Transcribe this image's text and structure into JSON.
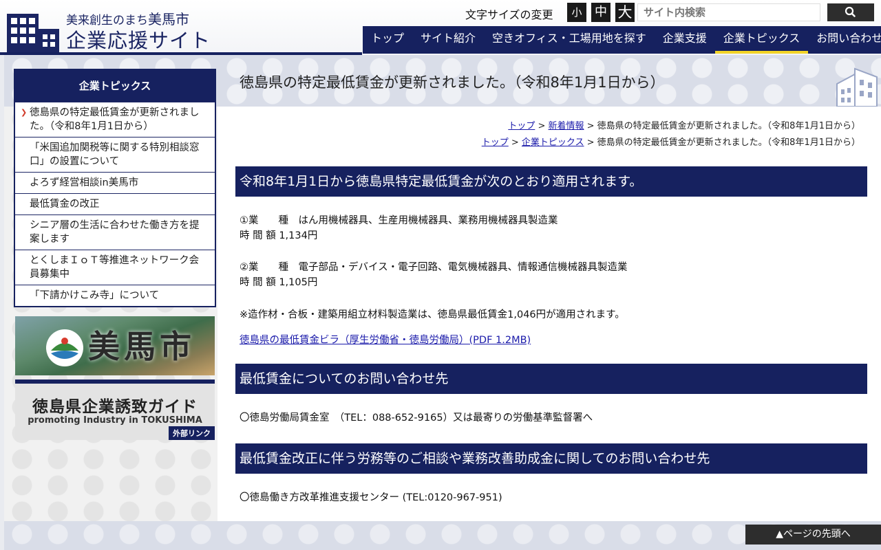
{
  "header": {
    "logo_sub": "美来創生のまち",
    "logo_city": "美馬市",
    "logo_main": "企業応援サイト",
    "fontsize_label": "文字サイズの変更",
    "fontsize_small": "小",
    "fontsize_mid": "中",
    "fontsize_large": "大",
    "search_placeholder": "サイト内検索"
  },
  "nav": [
    {
      "label": "トップ"
    },
    {
      "label": "サイト紹介"
    },
    {
      "label": "空きオフィス・工場用地を探す"
    },
    {
      "label": "企業支援"
    },
    {
      "label": "企業トピックス"
    },
    {
      "label": "お問い合わせ"
    }
  ],
  "sidebar": {
    "title": "企業トピックス",
    "items": [
      {
        "label": "徳島県の特定最低賃金が更新されました。（令和8年1月1日から）"
      },
      {
        "label": "「米国追加関税等に関する特別相談窓口」の設置について"
      },
      {
        "label": "よろず経営相談in美馬市"
      },
      {
        "label": "最低賃金の改正"
      },
      {
        "label": "シニア層の生活に合わせた働き方を提案します"
      },
      {
        "label": "とくしまＩｏＴ等推進ネットワーク会員募集中"
      },
      {
        "label": "「下請かけこみ寺」について"
      }
    ]
  },
  "banners": {
    "city_name": "美馬市",
    "guide_title": "徳島県企業誘致ガイド",
    "guide_sub": "promoting Industry in TOKUSHIMA",
    "guide_tag": "外部リンク"
  },
  "main": {
    "title": "徳島県の特定最低賃金が更新されました。（令和8年1月1日から）",
    "breadcrumb1": {
      "home": "トップ",
      "parent": "新着情報",
      "current": " > 徳島県の特定最低賃金が更新されました。（令和8年1月1日から）"
    },
    "breadcrumb2": {
      "home": "トップ",
      "parent": "企業トピックス",
      "current": " > 徳島県の特定最低賃金が更新されました。（令和8年1月1日から）"
    },
    "sep": " > ",
    "section1": "令和8年1月1日から徳島県特定最低賃金が次のとおり適用されます。",
    "item1_type": "①業　　種　はん用機械器具、生産用機械器具、業務用機械器具製造業",
    "item1_wage": "時 間 額 1,134円",
    "item2_type": "②業　　種　電子部品・デバイス・電子回路、電気機械器具、情報通信機械器具製造業",
    "item2_wage": "時 間 額 1,105円",
    "note": "※造作材・合板・建築用組立材料製造業は、徳島県最低賃金1,046円が適用されます。",
    "pdf_link": "徳島県の最低賃金ビラ（厚生労働省・徳島労働局）(PDF 1.2MB)",
    "section2": "最低賃金についてのお問い合わせ先",
    "contact1": "〇徳島労働局賃金室　（TEL：088-652-9165）又は最寄りの労働基準監督署へ",
    "section3": "最低賃金改正に伴う労務等のご相談や業務改善助成金に関してのお問い合わせ先",
    "contact2": "〇徳島働き方改革推進支援センター (TEL:0120-967-951)"
  },
  "pagetop": "▲ページの先頭へ",
  "colors": {
    "navy": "#16215f",
    "accent": "#f2d327",
    "link": "#1a1aaa"
  }
}
